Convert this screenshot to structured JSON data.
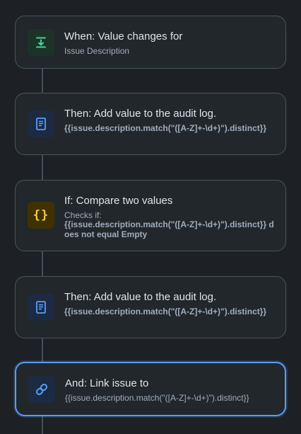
{
  "steps": [
    {
      "icon": "download-icon",
      "title": "When: Value changes for",
      "subtitle": "Issue Description"
    },
    {
      "icon": "document-icon",
      "title": "Then: Add value to the audit log.",
      "expression": "{{issue.description.match(\"([A-Z]+-\\d+)\").distinct}}"
    },
    {
      "icon": "curly-braces-icon",
      "glyph": "{}",
      "title": "If: Compare two values",
      "subtitle": "Checks if:",
      "expression": "{{issue.description.match(\"([A-Z]+-\\d+)\").distinct}} does not equal Empty"
    },
    {
      "icon": "document-icon",
      "title": "Then: Add value to the audit log.",
      "expression": "{{issue.description.match(\"([A-Z]+-\\d+)\").distinct}}"
    },
    {
      "icon": "link-icon",
      "title": "And: Link issue to",
      "expression": "{{issue.description.match(\"([A-Z]+-\\d+)\").distinct}}",
      "selected": true
    }
  ],
  "colors": {
    "background": "#1d2125",
    "card": "#22272b",
    "selected_border": "#579dff",
    "trigger_icon": "#4bce97",
    "action_icon": "#579dff",
    "condition_icon": "#f5cd47"
  }
}
